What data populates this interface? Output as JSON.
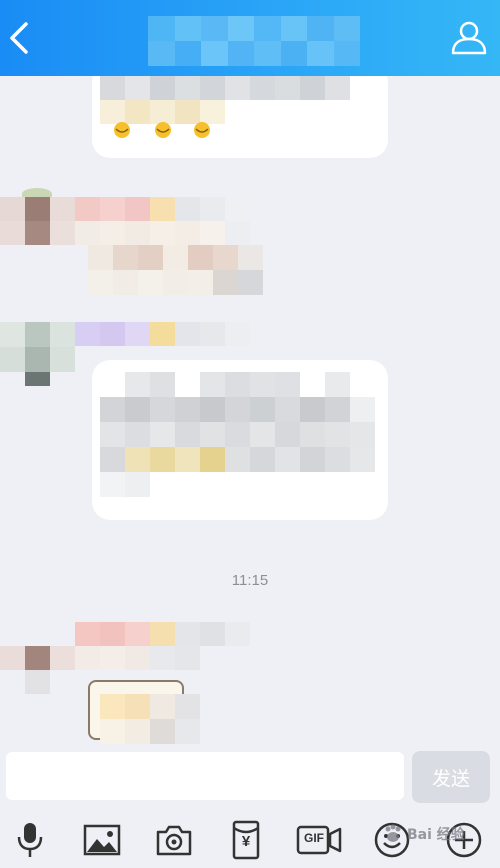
{
  "header": {
    "title": ""
  },
  "chat": {
    "timestamp": "11:15"
  },
  "composer": {
    "input_value": "",
    "input_placeholder": "",
    "send_label": "发送"
  },
  "toolbar": {
    "tools": [
      "microphone-icon",
      "image-icon",
      "camera-icon",
      "red-packet-icon",
      "gif-icon",
      "emoji-icon",
      "plus-icon"
    ],
    "red_packet_symbol": "¥",
    "gif_label": "GIF"
  },
  "watermark": {
    "text": "Bai 经验"
  },
  "colors": {
    "header_start": "#1a8cf5",
    "header_end": "#35b7f6",
    "background": "#eef0f5",
    "bubble": "#ffffff",
    "send_disabled": "#d9dde3",
    "icon": "#333333"
  }
}
